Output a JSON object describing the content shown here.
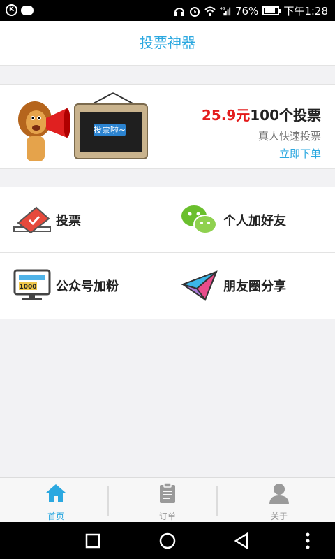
{
  "status_bar": {
    "battery": "76%",
    "time": "下午1:28",
    "network": "4G"
  },
  "header": {
    "title": "投票神器"
  },
  "banner": {
    "sign_text": "投票啦~",
    "price": "25.9元",
    "price_suffix": "100个投票",
    "subtitle": "真人快速投票",
    "cta": "立即下单"
  },
  "services": [
    {
      "label": "投票",
      "icon": "ballot-box-icon"
    },
    {
      "label": "个人加好友",
      "icon": "wechat-icon"
    },
    {
      "label": "公众号加粉",
      "icon": "monitor-icon",
      "badge": "1000"
    },
    {
      "label": "朋友圈分享",
      "icon": "paper-plane-icon"
    }
  ],
  "tabs": [
    {
      "label": "首页",
      "icon": "home-icon",
      "active": true
    },
    {
      "label": "订单",
      "icon": "clipboard-icon",
      "active": false
    },
    {
      "label": "关于",
      "icon": "person-icon",
      "active": false
    }
  ],
  "colors": {
    "accent": "#2ba8e0",
    "price": "#e41c1c",
    "background": "#f2f2f4"
  }
}
